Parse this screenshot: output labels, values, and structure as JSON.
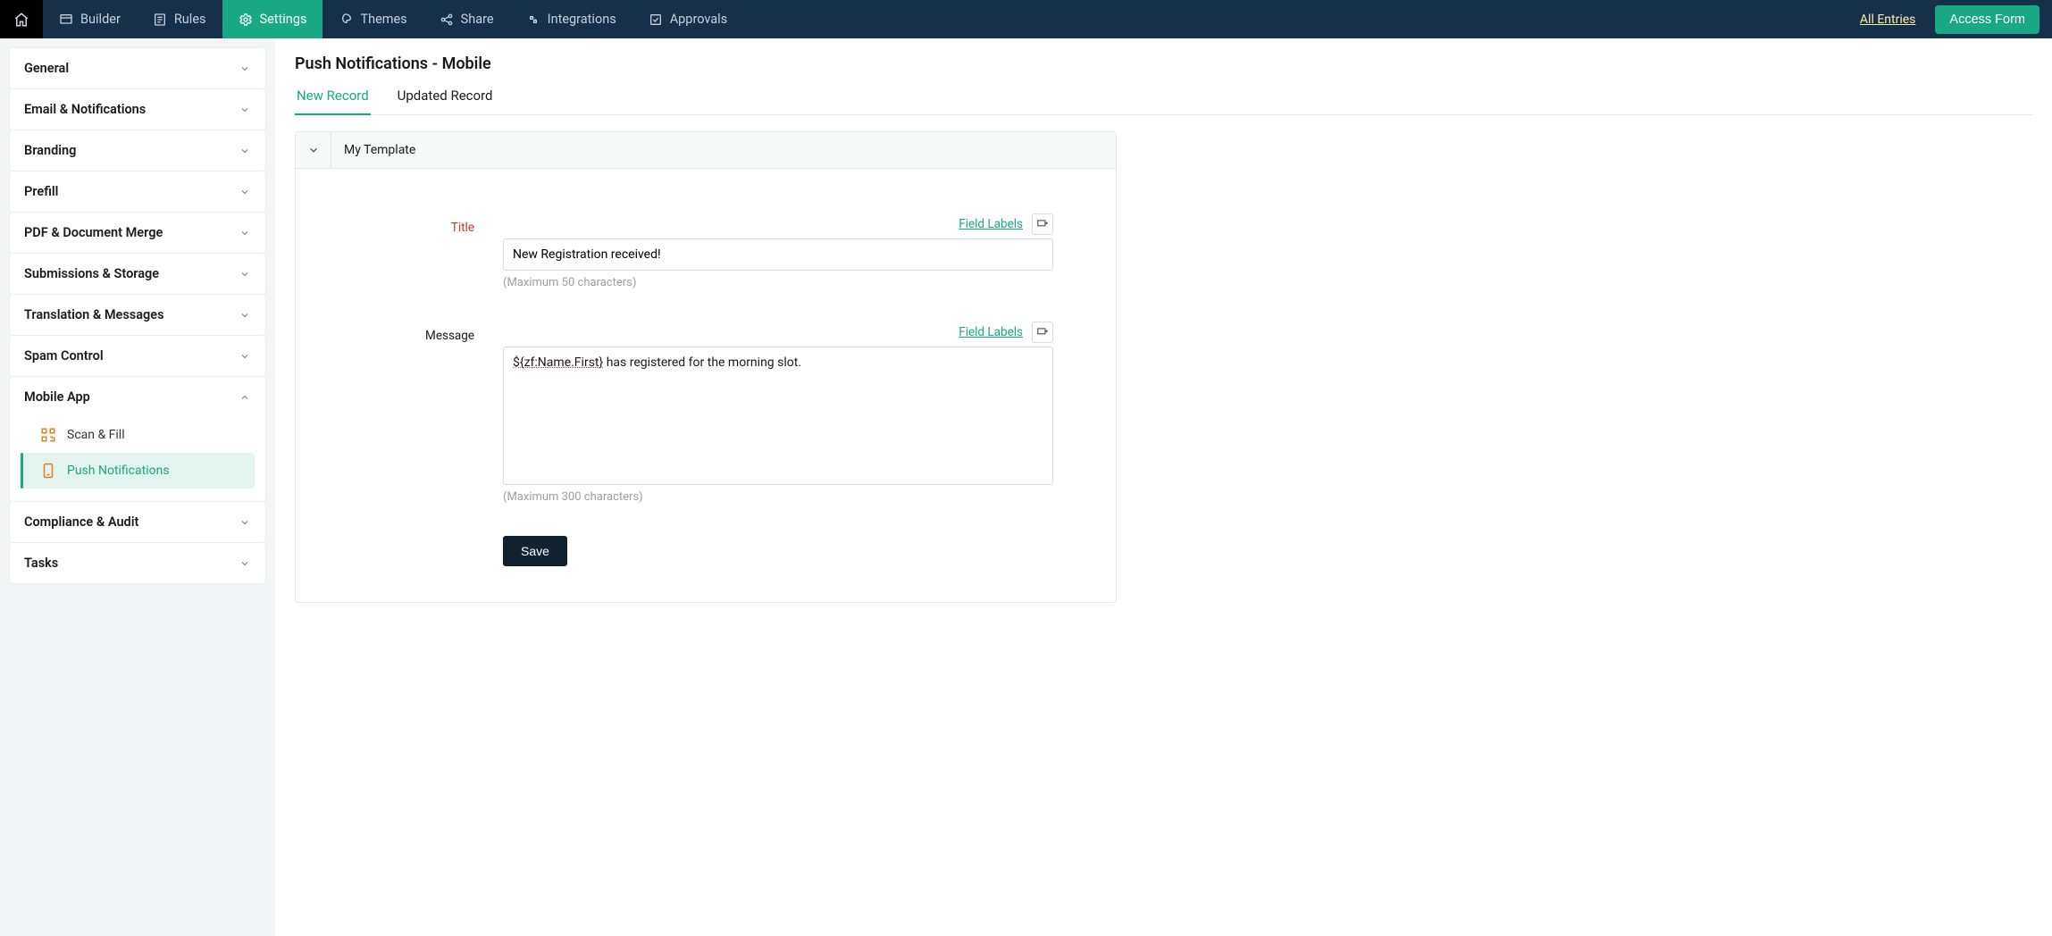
{
  "nav": {
    "tabs": [
      {
        "label": "Builder"
      },
      {
        "label": "Rules"
      },
      {
        "label": "Settings"
      },
      {
        "label": "Themes"
      },
      {
        "label": "Share"
      },
      {
        "label": "Integrations"
      },
      {
        "label": "Approvals"
      }
    ],
    "all_entries": "All Entries",
    "access_form": "Access Form"
  },
  "sidebar": {
    "items": [
      {
        "label": "General"
      },
      {
        "label": "Email & Notifications"
      },
      {
        "label": "Branding"
      },
      {
        "label": "Prefill"
      },
      {
        "label": "PDF & Document Merge"
      },
      {
        "label": "Submissions & Storage"
      },
      {
        "label": "Translation & Messages"
      },
      {
        "label": "Spam Control"
      },
      {
        "label": "Mobile App",
        "children": [
          {
            "label": "Scan & Fill"
          },
          {
            "label": "Push Notifications",
            "active": true
          }
        ]
      },
      {
        "label": "Compliance & Audit"
      },
      {
        "label": "Tasks"
      }
    ]
  },
  "page": {
    "title": "Push Notifications - Mobile",
    "tabs": [
      {
        "label": "New Record",
        "active": true
      },
      {
        "label": "Updated Record"
      }
    ]
  },
  "panel": {
    "header": "My Template",
    "field_labels_link": "Field Labels",
    "title_label": "Title",
    "title_value": "New Registration received!",
    "title_hint": "(Maximum 50 characters)",
    "message_label": "Message",
    "message_prefix": "${zf:Name.First}",
    "message_suffix": " has registered for the morning slot.",
    "message_hint": "(Maximum 300 characters)",
    "save_label": "Save"
  }
}
